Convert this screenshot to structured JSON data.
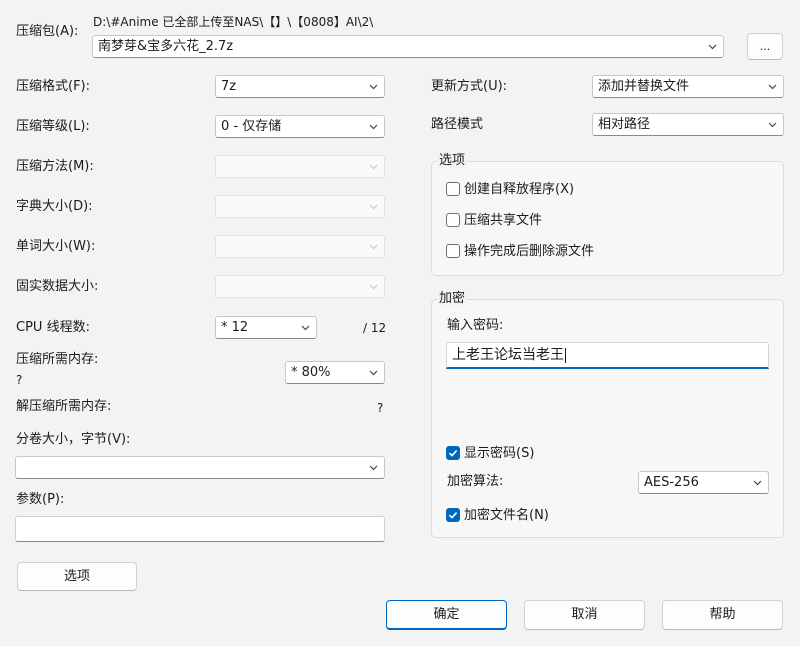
{
  "archive": {
    "label": "压缩包(A):",
    "path": "D:\\#Anime 已全部上传至NAS\\【】\\【0808】AI\\2\\",
    "name": "南梦芽&宝多六花_2.7z",
    "browse_label": "..."
  },
  "left": {
    "format_label": "压缩格式(F):",
    "format_value": "7z",
    "level_label": "压缩等级(L):",
    "level_value": "0 - 仅存储",
    "method_label": "压缩方法(M):",
    "dict_label": "字典大小(D):",
    "word_label": "单词大小(W):",
    "solid_label": "固实数据大小:",
    "threads_label": "CPU 线程数:",
    "threads_value": "* 12",
    "threads_max": "/ 12",
    "mem_compress_label": "压缩所需内存:",
    "mem_compress_value": "?",
    "mem_compress_percent": "* 80%",
    "mem_decompress_label": "解压缩所需内存:",
    "mem_decompress_value": "?",
    "volume_label": "分卷大小，字节(V):",
    "volume_value": "",
    "params_label": "参数(P):",
    "params_value": "",
    "options_button": "选项"
  },
  "right": {
    "update_label": "更新方式(U):",
    "update_value": "添加并替换文件",
    "path_mode_label": "路径模式",
    "path_mode_value": "相对路径",
    "options_group": {
      "title": "选项",
      "sfx": {
        "label": "创建自释放程序(X)",
        "checked": false
      },
      "shared": {
        "label": "压缩共享文件",
        "checked": false
      },
      "delete": {
        "label": "操作完成后删除源文件",
        "checked": false
      }
    },
    "encryption_group": {
      "title": "加密",
      "password_label": "输入密码:",
      "password_value": "上老王论坛当老王",
      "show_password": {
        "label": "显示密码(S)",
        "checked": true
      },
      "method_label": "加密算法:",
      "method_value": "AES-256",
      "encrypt_names": {
        "label": "加密文件名(N)",
        "checked": true
      }
    }
  },
  "footer": {
    "ok": "确定",
    "cancel": "取消",
    "help": "帮助"
  },
  "colors": {
    "accent": "#0067c0",
    "background": "#f3f3f3"
  }
}
